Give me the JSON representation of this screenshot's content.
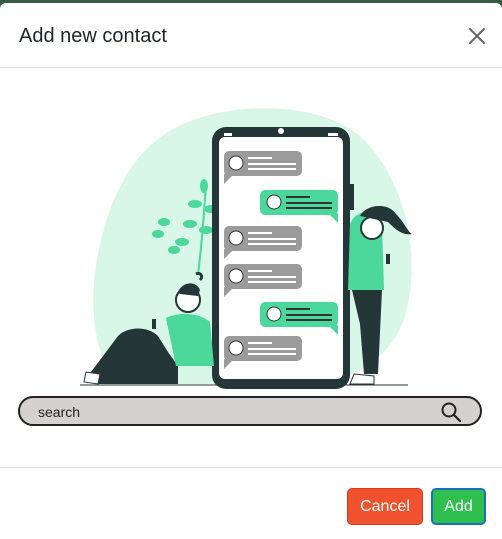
{
  "dialog": {
    "title": "Add new contact",
    "close_icon": "close-icon"
  },
  "search": {
    "placeholder": "search",
    "icon": "search-icon"
  },
  "footer": {
    "cancel_label": "Cancel",
    "add_label": "Add"
  },
  "colors": {
    "accent_green": "#4cd89a",
    "cancel_red": "#f0522f",
    "add_green": "#2ebf4f",
    "blob_mint": "#d9f7e8"
  }
}
